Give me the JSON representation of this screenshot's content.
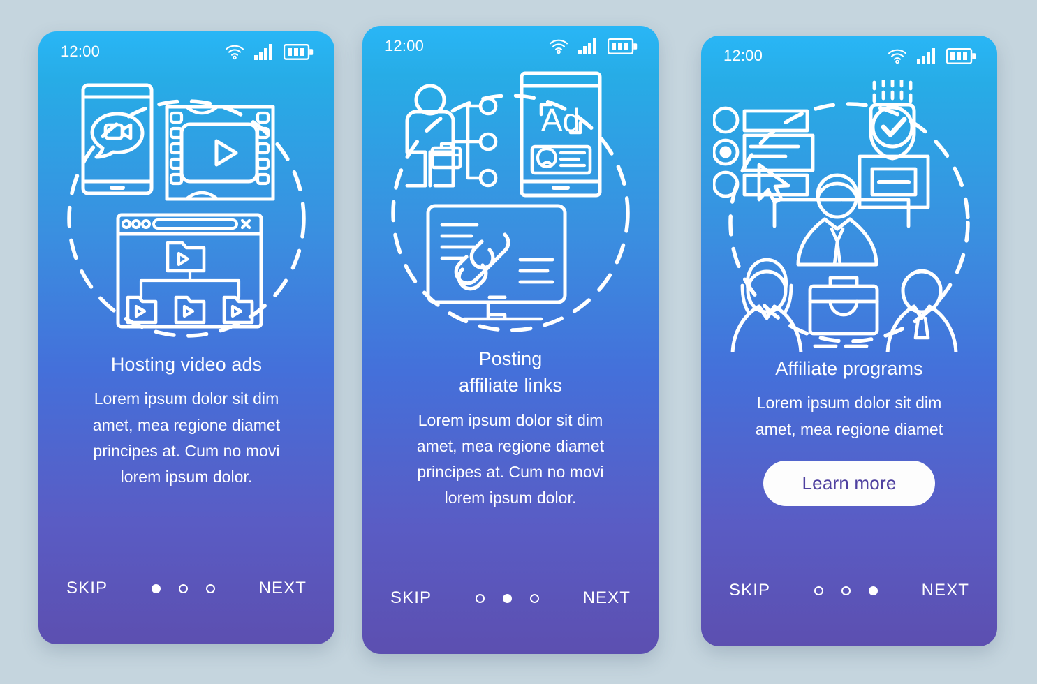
{
  "background_color": "#c5d5de",
  "theme": {
    "gradient_top": "#29b6f6",
    "gradient_bottom": "#5c4fb0",
    "cta_bg": "#ffffff",
    "cta_text_color": "#4f41a0",
    "text_color": "#ffffff"
  },
  "status_bar": {
    "time": "12:00",
    "icons": [
      "wifi-icon",
      "cellular-signal-icon",
      "battery-icon"
    ]
  },
  "nav": {
    "skip_label": "SKIP",
    "next_label": "NEXT",
    "dot_count": 3
  },
  "screens": [
    {
      "id": "hosting-video-ads",
      "illustration": "video-hosting-illustration",
      "title": "Hosting  video ads",
      "body": "Lorem ipsum dolor sit dim\namet, mea regione diamet\nprincipes at. Cum no movi\nlorem ipsum dolor.",
      "cta": null,
      "active_dot": 1
    },
    {
      "id": "posting-affiliate-links",
      "illustration": "affiliate-links-illustration",
      "title": "Posting\naffiliate links",
      "body": "Lorem ipsum dolor sit dim\namet, mea regione diamet\nprincipes at. Cum no movi\nlorem ipsum dolor.",
      "cta": null,
      "active_dot": 2
    },
    {
      "id": "affiliate-programs",
      "illustration": "affiliate-programs-illustration",
      "title": "Affiliate programs",
      "body": "Lorem ipsum dolor sit dim\namet, mea regione diamet",
      "cta": "Learn more",
      "active_dot": 3
    }
  ]
}
